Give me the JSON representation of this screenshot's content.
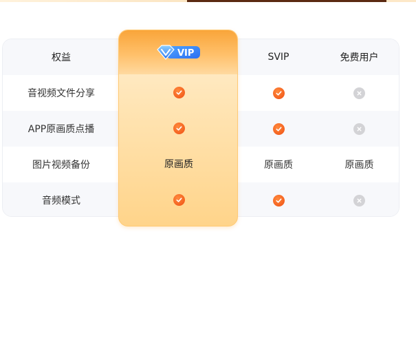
{
  "columns": {
    "label": "权益",
    "vip": "VIP",
    "svip": "SVIP",
    "free": "免费用户"
  },
  "rows": [
    {
      "label": "音视频文件分享",
      "vip": "check-icon",
      "svip": "check-icon",
      "free": "cross-icon"
    },
    {
      "label": "APP原画质点播",
      "vip": "check-icon",
      "svip": "check-icon",
      "free": "cross-icon"
    },
    {
      "label": "图片视频备份",
      "vip": "原画质",
      "svip": "原画质",
      "free": "原画质"
    },
    {
      "label": "音频模式",
      "vip": "check-icon",
      "svip": "check-icon",
      "free": "cross-icon"
    }
  ],
  "colors": {
    "accent_orange": "#f4601f",
    "vip_gold": "#ffd48a",
    "vip_blue": "#2b6ff2",
    "header_dark": "#5b2a12",
    "disabled": "#d3d3d6"
  }
}
